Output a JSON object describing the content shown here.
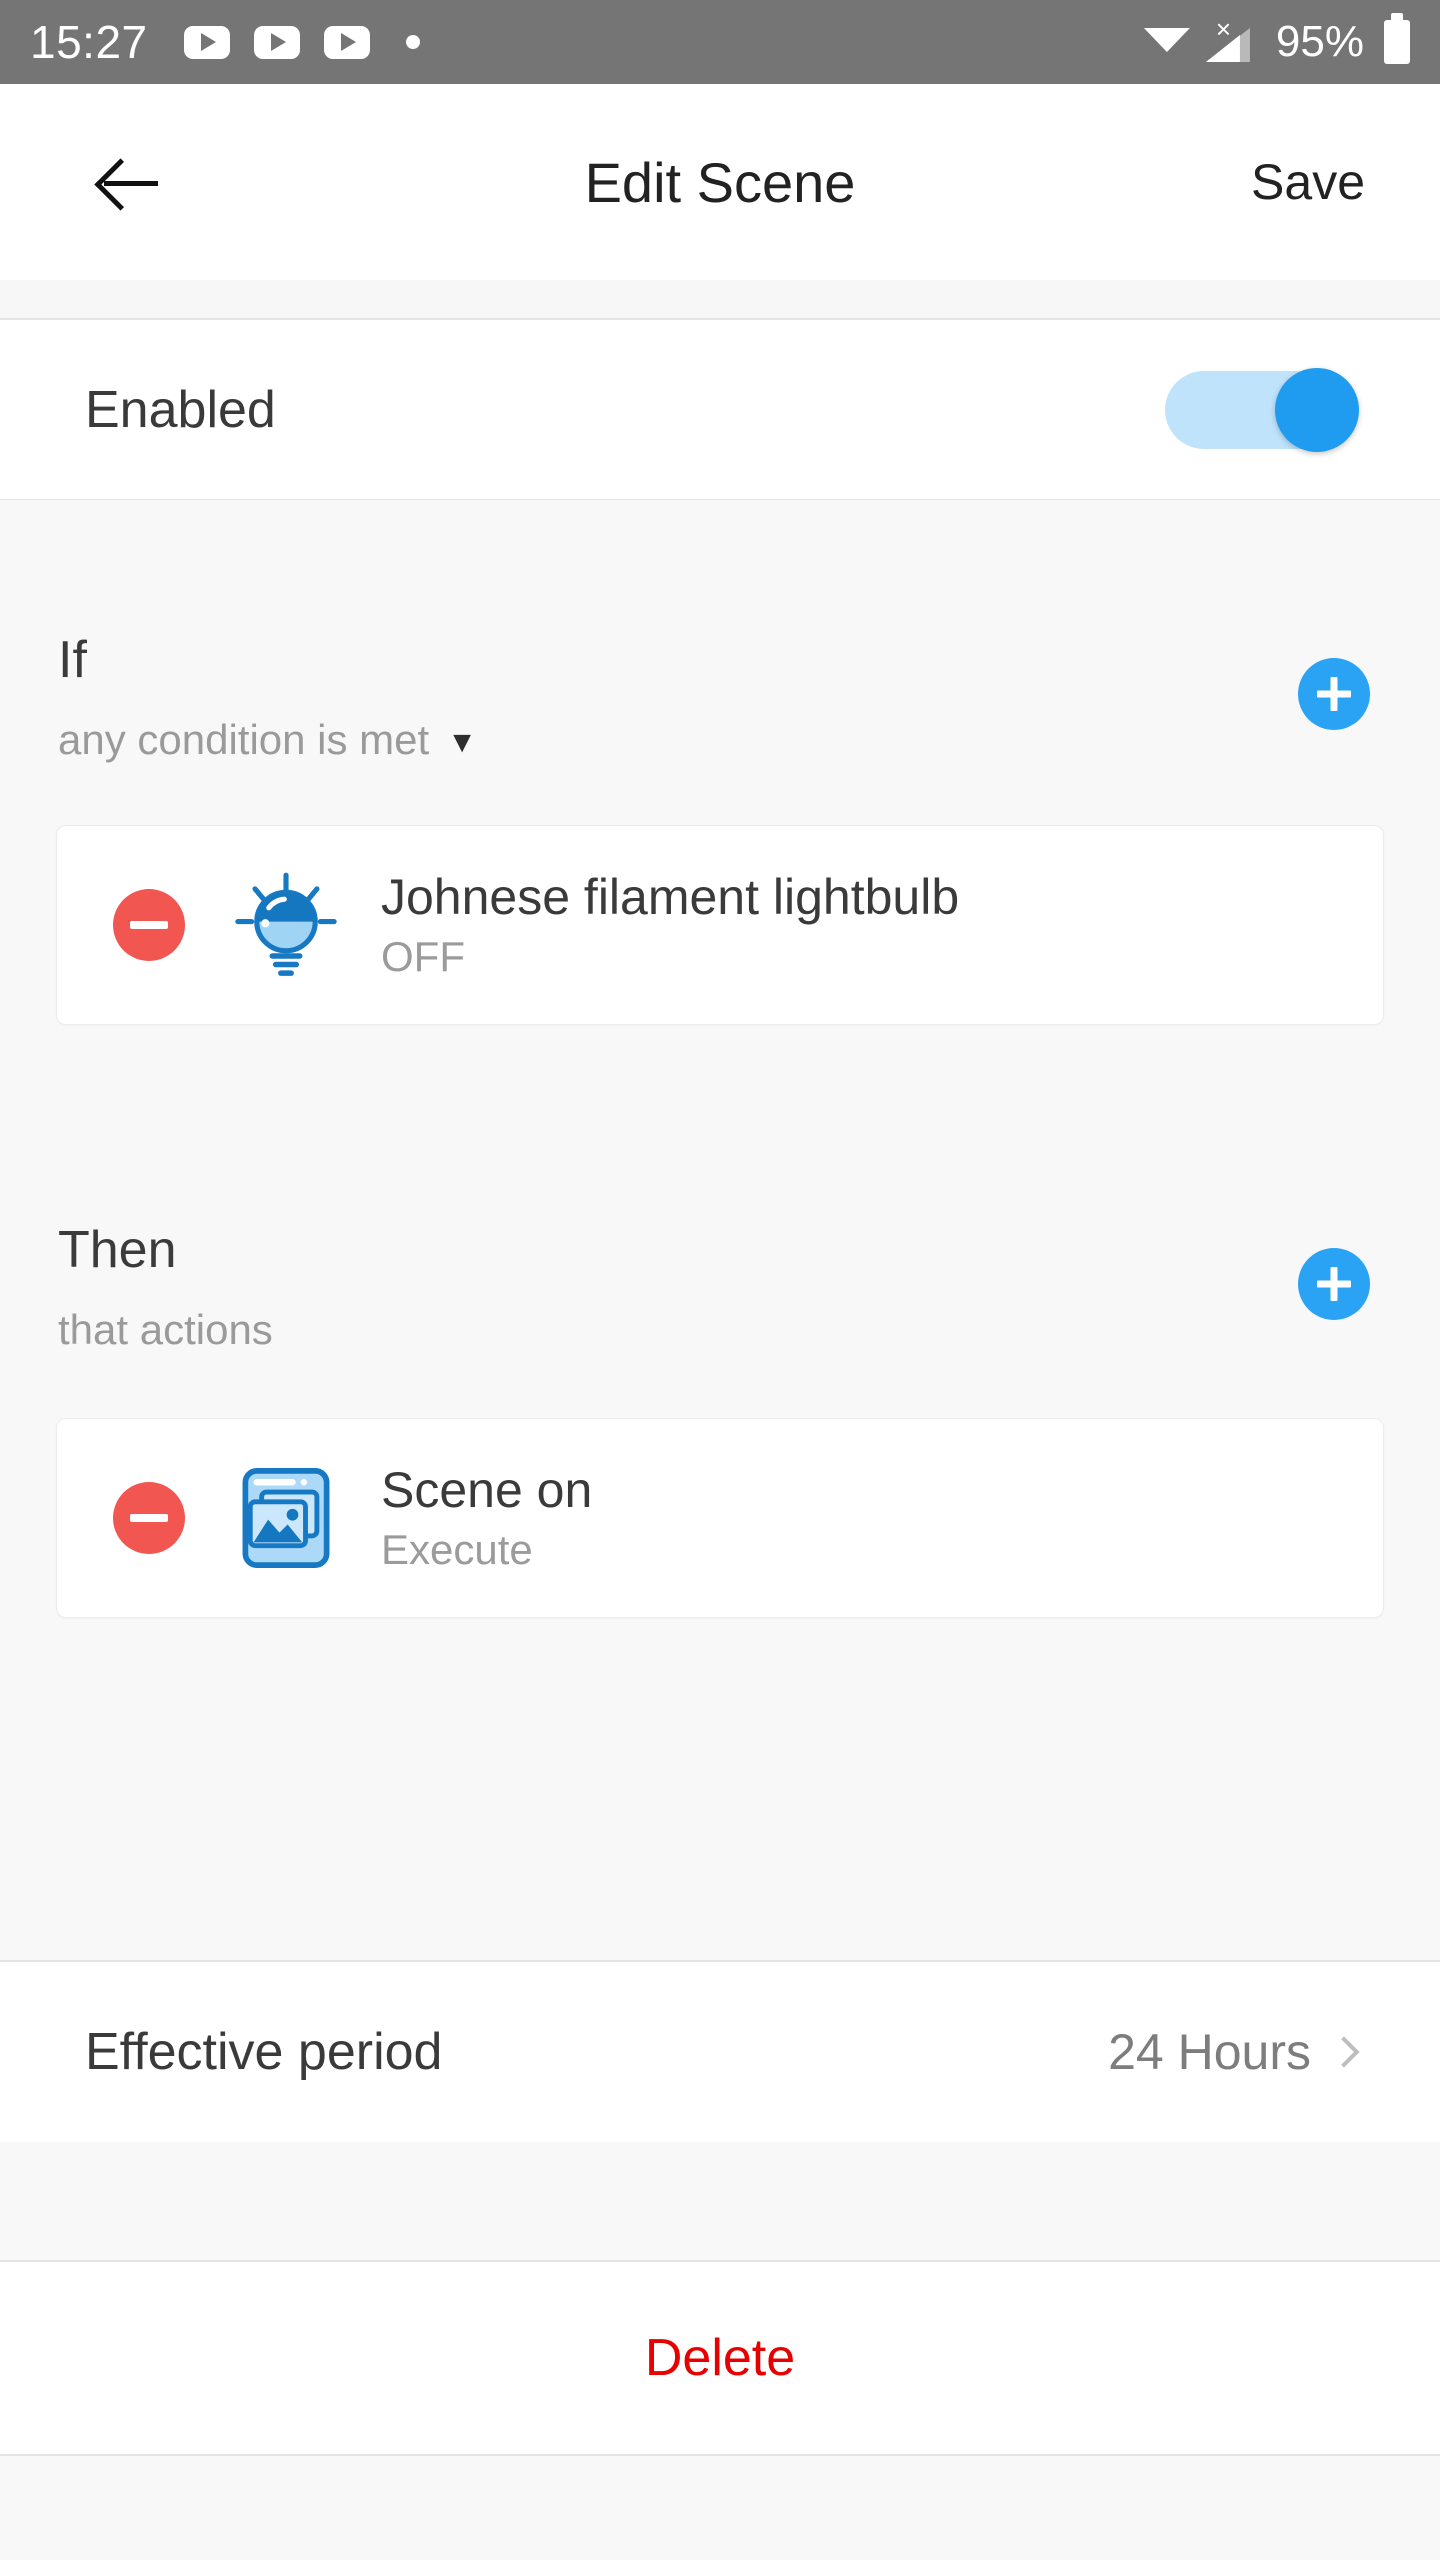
{
  "status_bar": {
    "time": "15:27",
    "notification_icons": [
      "youtube-play-icon",
      "youtube-play-icon",
      "youtube-play-icon",
      "dot-icon"
    ],
    "wifi": "wifi-icon",
    "signal": "cellular-signal-no-sim-icon",
    "battery_percent": "95%",
    "battery": "battery-icon",
    "background_color": "#757575"
  },
  "app_bar": {
    "back": "back-arrow-icon",
    "title": "Edit Scene",
    "save_label": "Save"
  },
  "enabled": {
    "label": "Enabled",
    "state": "on",
    "track_color": "#bfe3fb",
    "thumb_color": "#1f9bf0"
  },
  "if_section": {
    "title": "If",
    "subtitle": "any condition is met",
    "caret": "▼",
    "add_label": "add-condition",
    "conditions": [
      {
        "icon": "lightbulb-icon",
        "title": "Johnese filament lightbulb",
        "subtitle": "OFF",
        "remove": "remove-condition"
      }
    ]
  },
  "then_section": {
    "title": "Then",
    "subtitle": "that actions",
    "add_label": "add-action",
    "actions": [
      {
        "icon": "scene-picture-icon",
        "title": "Scene on",
        "subtitle": "Execute",
        "remove": "remove-action"
      }
    ]
  },
  "effective_period": {
    "label": "Effective period",
    "value": "24 Hours",
    "chevron": "chevron-right-icon"
  },
  "delete": {
    "label": "Delete",
    "color": "#e60000"
  },
  "colors": {
    "accent_blue": "#2ba3f5",
    "danger_red": "#f25650",
    "page_background": "#f8f8f8",
    "card_background": "#ffffff"
  }
}
